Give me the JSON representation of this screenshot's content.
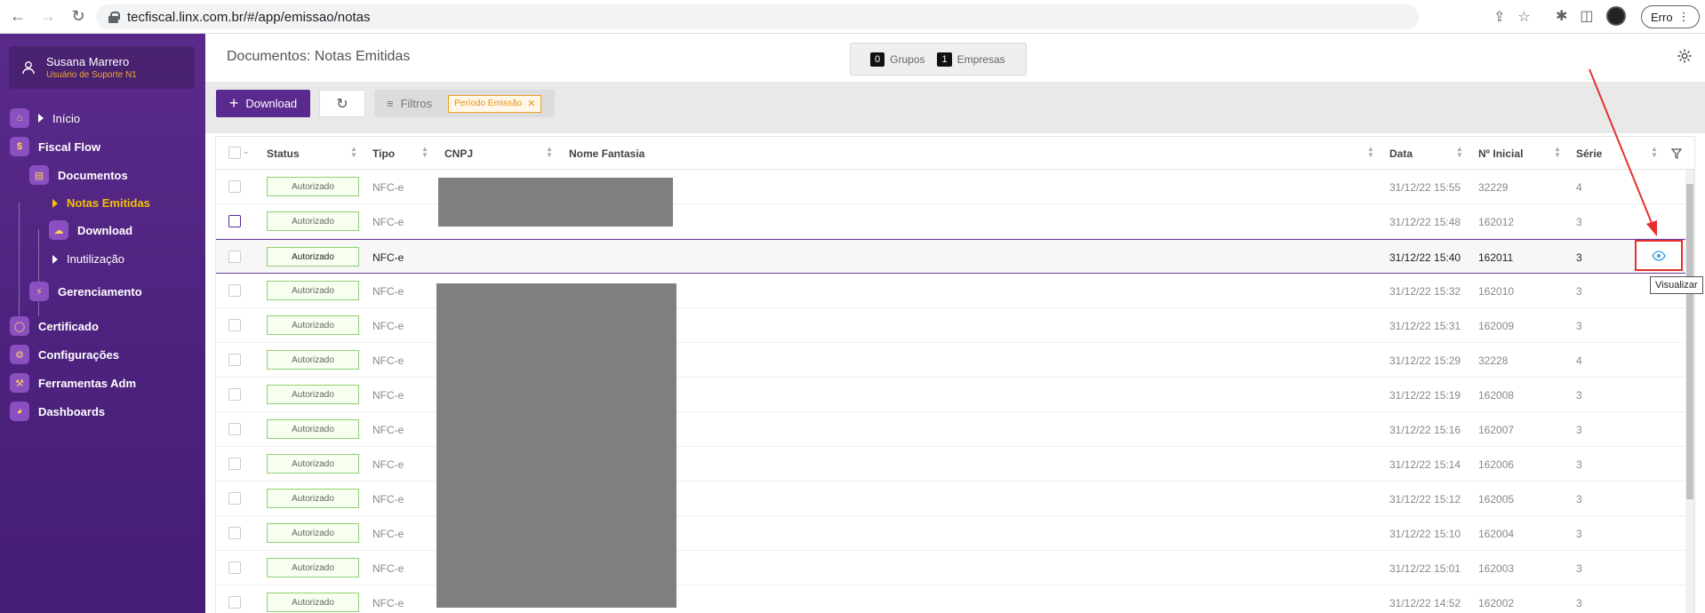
{
  "browser": {
    "url": "tecfiscal.linx.com.br/#/app/emissao/notas",
    "error_label": "Erro"
  },
  "user": {
    "name": "Susana Marrero",
    "role": "Usuário de Suporte N1"
  },
  "menu": {
    "inicio": "Início",
    "fiscal_flow": "Fiscal Flow",
    "documentos": "Documentos",
    "notas_emitidas": "Notas Emitidas",
    "download": "Download",
    "inutilizacao": "Inutilização",
    "gerenciamento": "Gerenciamento",
    "certificado": "Certificado",
    "configuracoes": "Configurações",
    "ferramentas": "Ferramentas Adm",
    "dashboards": "Dashboards"
  },
  "header": {
    "title": "Documentos: Notas Emitidas",
    "groups_count": "0",
    "groups_label": "Grupos",
    "companies_count": "1",
    "companies_label": "Empresas"
  },
  "toolbar": {
    "download_label": "Download",
    "filters_label": "Filtros",
    "filter_tag": "Período Emissão"
  },
  "table": {
    "columns": {
      "status": "Status",
      "tipo": "Tipo",
      "cnpj": "CNPJ",
      "nome": "Nome Fantasia",
      "data": "Data",
      "numero": "Nº Inicial",
      "serie": "Série"
    },
    "rows": [
      {
        "status": "Autorizado",
        "tipo": "NFC-e",
        "data": "31/12/22 15:55",
        "numero": "32229",
        "serie": "4"
      },
      {
        "status": "Autorizado",
        "tipo": "NFC-e",
        "data": "31/12/22 15:48",
        "numero": "162012",
        "serie": "3"
      },
      {
        "status": "Autorizado",
        "tipo": "NFC-e",
        "data": "31/12/22 15:40",
        "numero": "162011",
        "serie": "3"
      },
      {
        "status": "Autorizado",
        "tipo": "NFC-e",
        "data": "31/12/22 15:32",
        "numero": "162010",
        "serie": "3"
      },
      {
        "status": "Autorizado",
        "tipo": "NFC-e",
        "data": "31/12/22 15:31",
        "numero": "162009",
        "serie": "3"
      },
      {
        "status": "Autorizado",
        "tipo": "NFC-e",
        "data": "31/12/22 15:29",
        "numero": "32228",
        "serie": "4"
      },
      {
        "status": "Autorizado",
        "tipo": "NFC-e",
        "data": "31/12/22 15:19",
        "numero": "162008",
        "serie": "3"
      },
      {
        "status": "Autorizado",
        "tipo": "NFC-e",
        "data": "31/12/22 15:16",
        "numero": "162007",
        "serie": "3"
      },
      {
        "status": "Autorizado",
        "tipo": "NFC-e",
        "data": "31/12/22 15:14",
        "numero": "162006",
        "serie": "3"
      },
      {
        "status": "Autorizado",
        "tipo": "NFC-e",
        "data": "31/12/22 15:12",
        "numero": "162005",
        "serie": "3"
      },
      {
        "status": "Autorizado",
        "tipo": "NFC-e",
        "data": "31/12/22 15:10",
        "numero": "162004",
        "serie": "3"
      },
      {
        "status": "Autorizado",
        "tipo": "NFC-e",
        "data": "31/12/22 15:01",
        "numero": "162003",
        "serie": "3"
      },
      {
        "status": "Autorizado",
        "tipo": "NFC-e",
        "data": "31/12/22 14:52",
        "numero": "162002",
        "serie": "3"
      }
    ]
  },
  "tooltip": "Visualizar",
  "colors": {
    "sidebar": "#4e2380",
    "accent": "#5b2a8e",
    "active": "#f5c000",
    "highlight": "#e53030"
  }
}
